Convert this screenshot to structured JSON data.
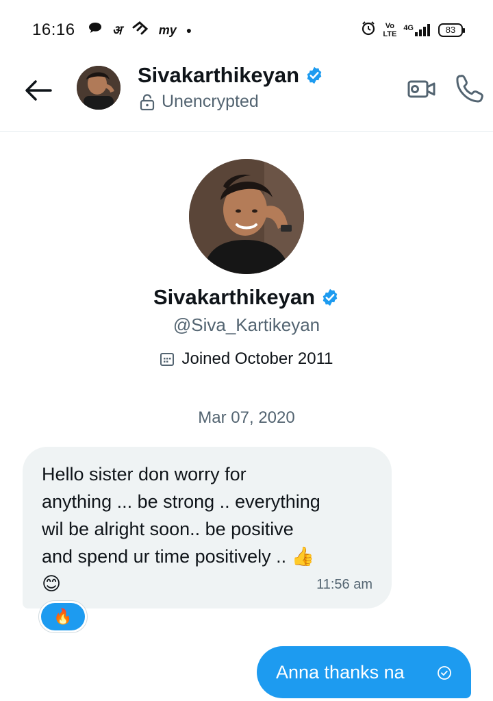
{
  "status_bar": {
    "time": "16:16",
    "volte": "Vo\nLTE",
    "network": "4G",
    "battery": "83"
  },
  "header": {
    "name": "Sivakarthikeyan",
    "encryption_label": "Unencrypted"
  },
  "profile": {
    "name": "Sivakarthikeyan",
    "handle": "@Siva_Kartikeyan",
    "joined": "Joined October 2011"
  },
  "conversation": {
    "date_separator": "Mar 07, 2020",
    "messages": [
      {
        "direction": "incoming",
        "text": "Hello sister don worry for\nanything ... be strong .. everything\nwil be alright soon.. be positive\nand spend ur time positively  .. 👍\n😊",
        "time": "11:56 am",
        "reaction": "🔥"
      },
      {
        "direction": "outgoing",
        "text": "Anna thanks na"
      }
    ]
  },
  "colors": {
    "accent": "#1d9bf0",
    "bubble_incoming": "#eff3f4",
    "secondary_text": "#536471"
  }
}
